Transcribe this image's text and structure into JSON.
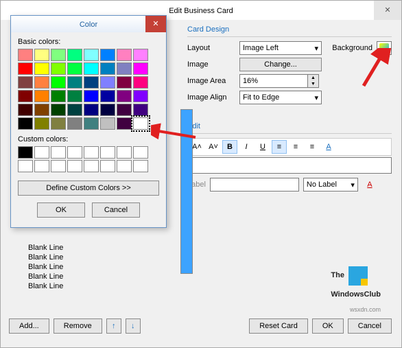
{
  "mainDialog": {
    "title": "Edit Business Card",
    "cardDesign": {
      "title": "Card Design",
      "layoutLabel": "Layout",
      "layoutValue": "Image Left",
      "backgroundLabel": "Background",
      "imageLabel": "Image",
      "changeBtn": "Change...",
      "imageAreaLabel": "Image Area",
      "imageAreaValue": "16%",
      "imageAlignLabel": "Image Align",
      "imageAlignValue": "Fit to Edge"
    },
    "edit": {
      "title": "Edit",
      "biggerA": "A˄",
      "smallerA": "A˅",
      "bold": "B",
      "italic": "I",
      "underline": "U",
      "alignLeft": "≡",
      "alignCenter": "≡",
      "alignRight": "≡",
      "fontColor": "A",
      "labelLabel": "Label",
      "noLabelValue": "No Label"
    },
    "blankLines": [
      "Blank Line",
      "Blank Line",
      "Blank Line",
      "Blank Line",
      "Blank Line"
    ],
    "addBtn": "Add...",
    "removeBtn": "Remove",
    "upIcon": "↑",
    "downIcon": "↓",
    "resetBtn": "Reset Card",
    "okBtn": "OK",
    "cancelBtn": "Cancel"
  },
  "colorDialog": {
    "title": "Color",
    "basicLabel": "Basic colors:",
    "customLabel": "Custom colors:",
    "defineBtn": "Define Custom Colors >>",
    "okBtn": "OK",
    "cancelBtn": "Cancel",
    "basicColors": [
      "#ff8080",
      "#ffff80",
      "#80ff80",
      "#00ff80",
      "#80ffff",
      "#0080ff",
      "#ff80c0",
      "#ff80ff",
      "#ff0000",
      "#ffff00",
      "#80ff00",
      "#00ff40",
      "#00ffff",
      "#0080c0",
      "#8080c0",
      "#ff00ff",
      "#804040",
      "#ff8040",
      "#00ff00",
      "#008080",
      "#004080",
      "#8080ff",
      "#800040",
      "#ff0080",
      "#800000",
      "#ff8000",
      "#008000",
      "#008040",
      "#0000ff",
      "#0000a0",
      "#800080",
      "#8000ff",
      "#400000",
      "#804000",
      "#004000",
      "#004040",
      "#000080",
      "#000040",
      "#400040",
      "#400080",
      "#000000",
      "#808000",
      "#808040",
      "#808080",
      "#408080",
      "#c0c0c0",
      "#400040",
      "#ffffff"
    ],
    "selectedIndex": 47,
    "customColors": [
      "#000000",
      "#ffffff",
      "#ffffff",
      "#ffffff",
      "#ffffff",
      "#ffffff",
      "#ffffff",
      "#ffffff",
      "#ffffff",
      "#ffffff",
      "#ffffff",
      "#ffffff",
      "#ffffff",
      "#ffffff",
      "#ffffff",
      "#ffffff"
    ]
  },
  "watermark": {
    "line1": "The",
    "line2": "WindowsClub",
    "sub": "wsxdn.com"
  }
}
